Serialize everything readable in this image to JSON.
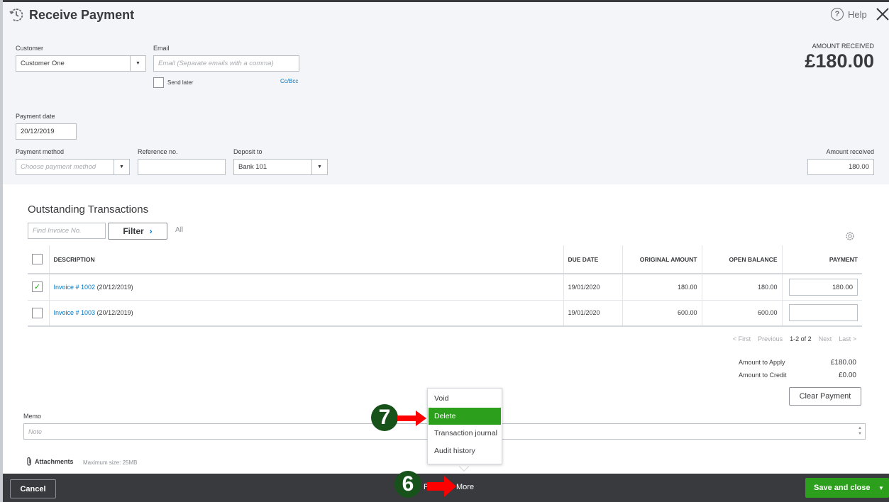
{
  "header": {
    "title": "Receive Payment",
    "help_label": "Help",
    "amount_received_label": "AMOUNT RECEIVED",
    "amount_received_value": "£180.00"
  },
  "form": {
    "customer": {
      "label": "Customer",
      "value": "Customer One"
    },
    "email": {
      "label": "Email",
      "placeholder": "Email (Separate emails with a comma)",
      "value": ""
    },
    "send_later": {
      "label": "Send later",
      "checked": false
    },
    "cc_bcc_label": "Cc/Bcc",
    "payment_date": {
      "label": "Payment date",
      "value": "20/12/2019"
    },
    "payment_method": {
      "label": "Payment method",
      "placeholder": "Choose payment method"
    },
    "reference_no": {
      "label": "Reference no.",
      "value": ""
    },
    "deposit_to": {
      "label": "Deposit to",
      "value": "Bank 101"
    },
    "amount_received": {
      "label": "Amount received",
      "value": "180.00"
    }
  },
  "transactions": {
    "title": "Outstanding Transactions",
    "find_placeholder": "Find Invoice No.",
    "filter_label": "Filter",
    "filter_value": "All",
    "columns": [
      "DESCRIPTION",
      "DUE DATE",
      "ORIGINAL AMOUNT",
      "OPEN BALANCE",
      "PAYMENT"
    ],
    "rows": [
      {
        "checked": true,
        "link": "Invoice # 1002",
        "date": "(20/12/2019)",
        "due_date": "19/01/2020",
        "original_amount": "180.00",
        "open_balance": "180.00",
        "payment": "180.00"
      },
      {
        "checked": false,
        "link": "Invoice # 1003",
        "date": "(20/12/2019)",
        "due_date": "19/01/2020",
        "original_amount": "600.00",
        "open_balance": "600.00",
        "payment": ""
      }
    ],
    "pager": {
      "first": "< First",
      "previous": "Previous",
      "current": "1-2 of 2",
      "next": "Next",
      "last": "Last >"
    }
  },
  "summary": {
    "amount_to_apply_label": "Amount to Apply",
    "amount_to_apply_value": "£180.00",
    "amount_to_credit_label": "Amount to Credit",
    "amount_to_credit_value": "£0.00",
    "clear_payment_label": "Clear Payment"
  },
  "memo": {
    "label": "Memo",
    "placeholder": "Note"
  },
  "attachments": {
    "label": "Attachments",
    "max_size": "Maximum size: 25MB"
  },
  "footer": {
    "cancel_label": "Cancel",
    "print_label": "Print",
    "more_label": "More",
    "save_label": "Save and close"
  },
  "more_menu": {
    "items": [
      {
        "label": "Void",
        "active": false
      },
      {
        "label": "Delete",
        "active": true
      },
      {
        "label": "Transaction journal",
        "active": false
      },
      {
        "label": "Audit history",
        "active": false
      }
    ]
  },
  "annotations": {
    "step_6": "6",
    "step_7": "7"
  },
  "colors": {
    "accent_green": "#2ca01c",
    "link_blue": "#0077c5",
    "footer_dark": "#393a3d",
    "annotation_red": "#ff0000",
    "annotation_circle": "#16521a"
  }
}
